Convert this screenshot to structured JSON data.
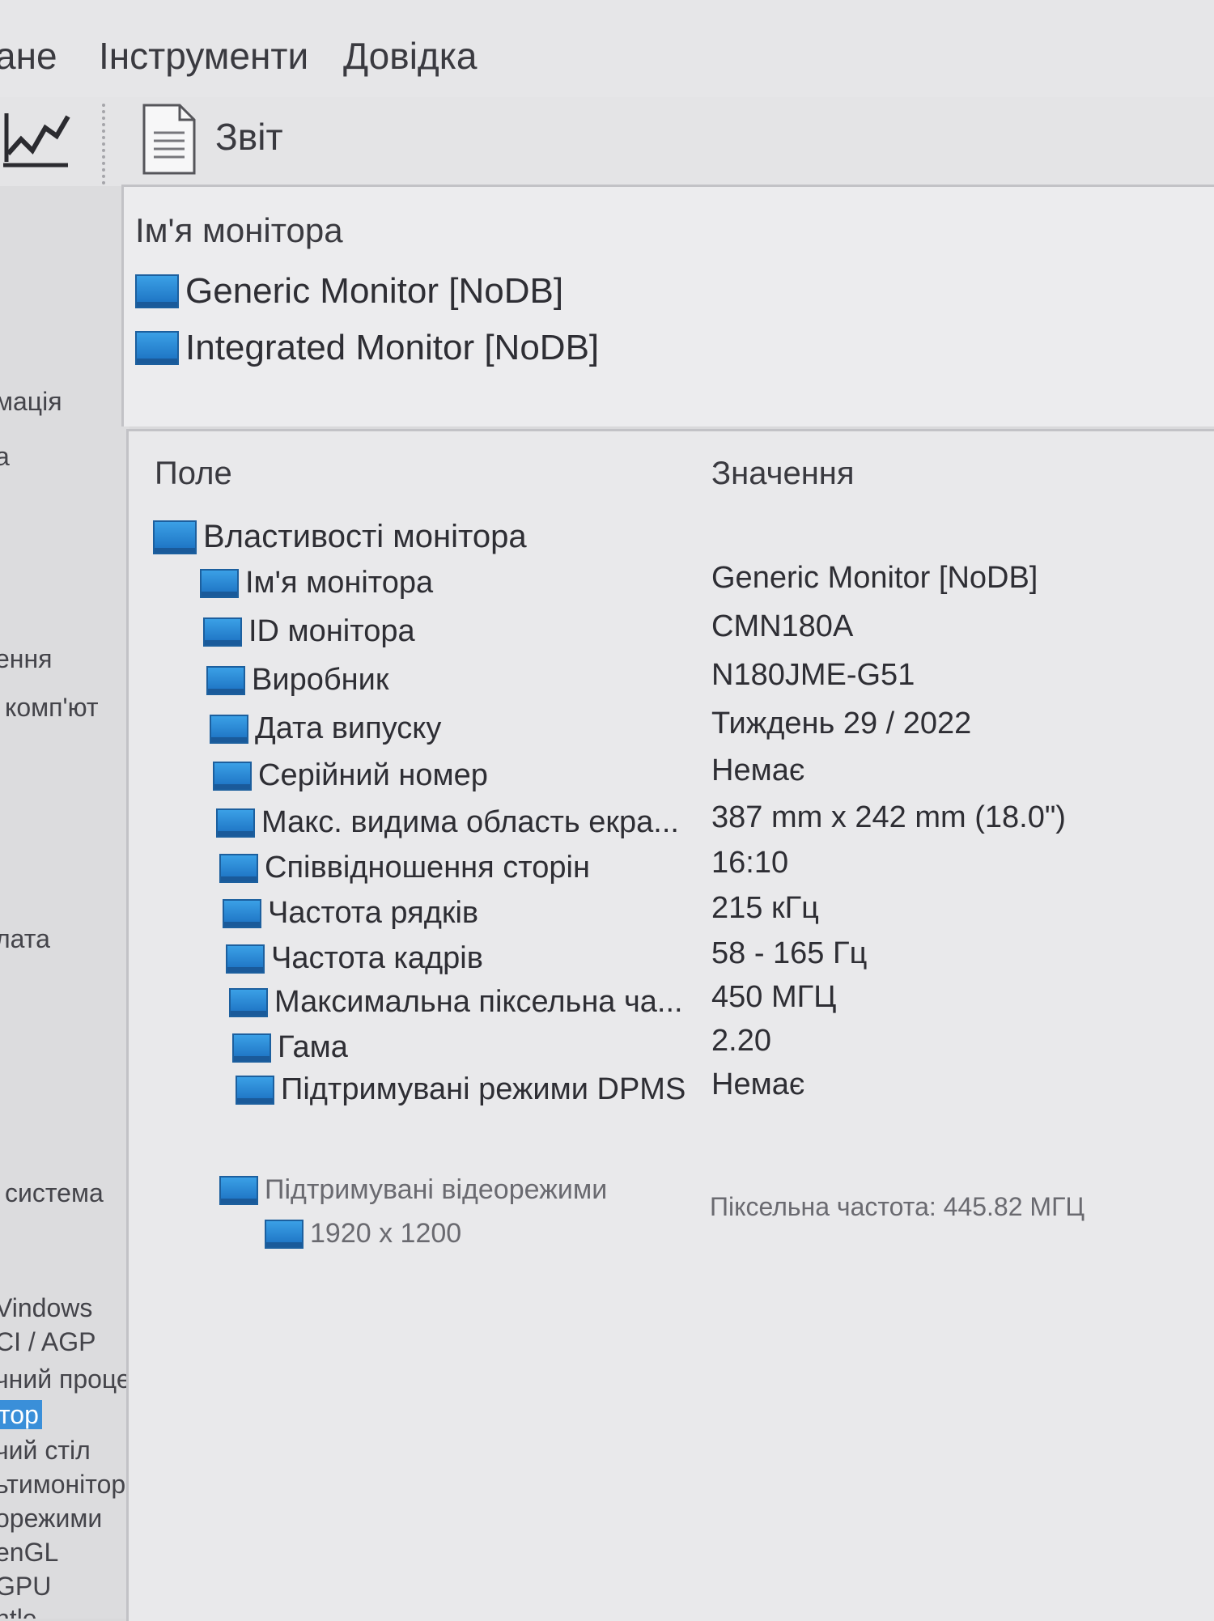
{
  "menu": {
    "items": [
      "ане",
      "Інструменти",
      "Довідка"
    ]
  },
  "toolbar": {
    "report_label": "Звіт"
  },
  "sidebar": {
    "items": [
      "мація",
      "а",
      "ення",
      "комп'ют",
      "лата",
      "система",
      "Vindows",
      "CI / AGP",
      "чний процесор",
      "тор",
      "чий стіл",
      "ьтимонітор",
      "орежими",
      "enGL",
      "GPU",
      "ntle"
    ]
  },
  "monitor_list": {
    "header": "Ім'я монітора",
    "items": [
      "Generic Monitor [NoDB]",
      "Integrated Monitor [NoDB]"
    ]
  },
  "details": {
    "col_field": "Поле",
    "col_value": "Значення",
    "group": "Властивості монітора",
    "rows": [
      {
        "field": "Ім'я монітора",
        "value": "Generic Monitor [NoDB]"
      },
      {
        "field": "ID монітора",
        "value": "CMN180A"
      },
      {
        "field": "Виробник",
        "value": "N180JME-G51"
      },
      {
        "field": "Дата випуску",
        "value": "Тиждень 29 / 2022"
      },
      {
        "field": "Серійний номер",
        "value": "Немає"
      },
      {
        "field": "Макс. видима область екра...",
        "value": "387 mm x 242 mm (18.0\")"
      },
      {
        "field": "Співвідношення сторін",
        "value": "16:10"
      },
      {
        "field": "Частота рядків",
        "value": "215 кГц"
      },
      {
        "field": "Частота кадрів",
        "value": "58 - 165 Гц"
      },
      {
        "field": "Максимальна піксельна ча...",
        "value": "450 МГЦ"
      },
      {
        "field": "Гама",
        "value": "2.20"
      },
      {
        "field": "Підтримувані режими DPMS",
        "value": "Немає"
      }
    ],
    "video_group": "Підтримувані відеорежими",
    "video_mode": {
      "field": "1920 x 1200",
      "value": "Піксельна частота: 445.82 МГЦ"
    }
  }
}
